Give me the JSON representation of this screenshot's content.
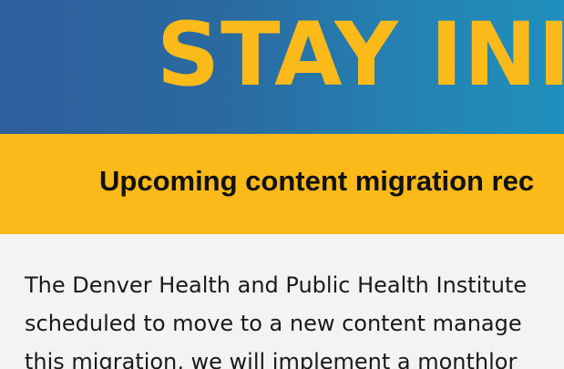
{
  "hero": {
    "title": "STAY INI"
  },
  "banner": {
    "heading": "Upcoming content migration rec"
  },
  "body": {
    "lines": [
      "The Denver Health and Public Health Institute",
      "scheduled to move to a new content manage",
      "this migration, we will implement a monthlor"
    ]
  },
  "colors": {
    "accent_yellow": "#fbb91a",
    "hero_blue_left": "#2e5e9c",
    "hero_blue_right": "#1f8fbd",
    "page_background": "#f3f3f3"
  }
}
